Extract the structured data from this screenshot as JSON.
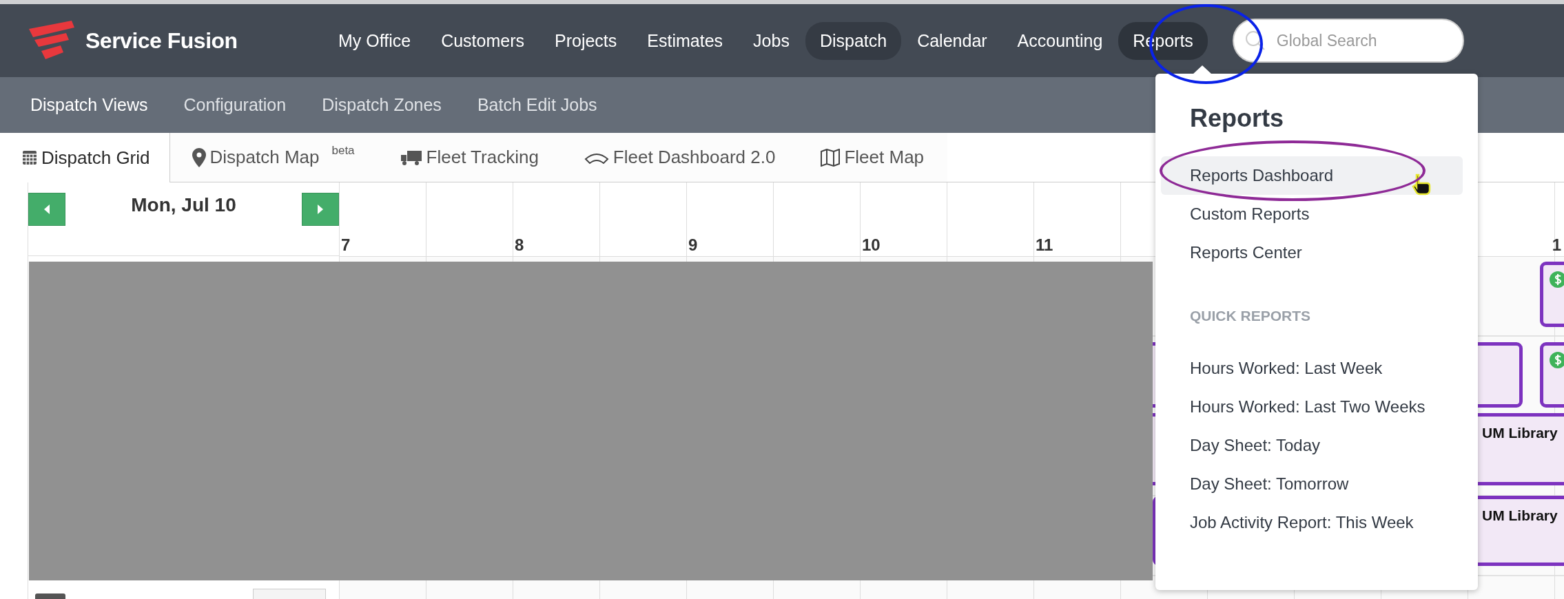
{
  "brand": {
    "name": "Service Fusion"
  },
  "main_nav": [
    {
      "label": "My Office",
      "selected": false,
      "open": false
    },
    {
      "label": "Customers",
      "selected": false,
      "open": false
    },
    {
      "label": "Projects",
      "selected": false,
      "open": false
    },
    {
      "label": "Estimates",
      "selected": false,
      "open": false
    },
    {
      "label": "Jobs",
      "selected": false,
      "open": false
    },
    {
      "label": "Dispatch",
      "selected": true,
      "open": false
    },
    {
      "label": "Calendar",
      "selected": false,
      "open": false
    },
    {
      "label": "Accounting",
      "selected": false,
      "open": false
    },
    {
      "label": "Reports",
      "selected": false,
      "open": true
    }
  ],
  "search": {
    "placeholder": "Global Search"
  },
  "sub_nav": [
    {
      "label": "Dispatch Views",
      "selected": true
    },
    {
      "label": "Configuration",
      "selected": false
    },
    {
      "label": "Dispatch Zones",
      "selected": false
    },
    {
      "label": "Batch Edit Jobs",
      "selected": false
    }
  ],
  "view_tabs": [
    {
      "label": "Dispatch Grid",
      "kind": "grid",
      "selected": true
    },
    {
      "label": "Dispatch Map",
      "kind": "pin",
      "badge": "beta",
      "selected": false
    },
    {
      "label": "Fleet Tracking",
      "kind": "truck",
      "selected": false
    },
    {
      "label": "Fleet Dashboard 2.0",
      "kind": "gauge",
      "selected": false
    },
    {
      "label": "Fleet Map",
      "kind": "map",
      "selected": false
    }
  ],
  "schedule": {
    "date": "Mon, Jul 10",
    "hours": [
      "7",
      "8",
      "9",
      "10",
      "11"
    ],
    "edge_hour": "1",
    "jobs": [
      {
        "paid": true
      },
      {
        "paid": true
      },
      {
        "title": "UM Library"
      },
      {
        "title": "UM Library"
      }
    ]
  },
  "reports_menu": {
    "title": "Reports",
    "items": [
      {
        "label": "Reports Dashboard",
        "highlighted": true
      },
      {
        "label": "Custom Reports",
        "highlighted": false
      },
      {
        "label": "Reports Center",
        "highlighted": false
      }
    ],
    "section_title": "QUICK REPORTS",
    "quick_reports": [
      {
        "label": "Hours Worked: Last Week",
        "highlighted": false
      },
      {
        "label": "Hours Worked: Last Two Weeks",
        "highlighted": false
      },
      {
        "label": "Day Sheet: Today",
        "highlighted": false
      },
      {
        "label": "Day Sheet: Tomorrow",
        "highlighted": false
      },
      {
        "label": "Job Activity Report: This Week",
        "highlighted": false
      }
    ]
  }
}
